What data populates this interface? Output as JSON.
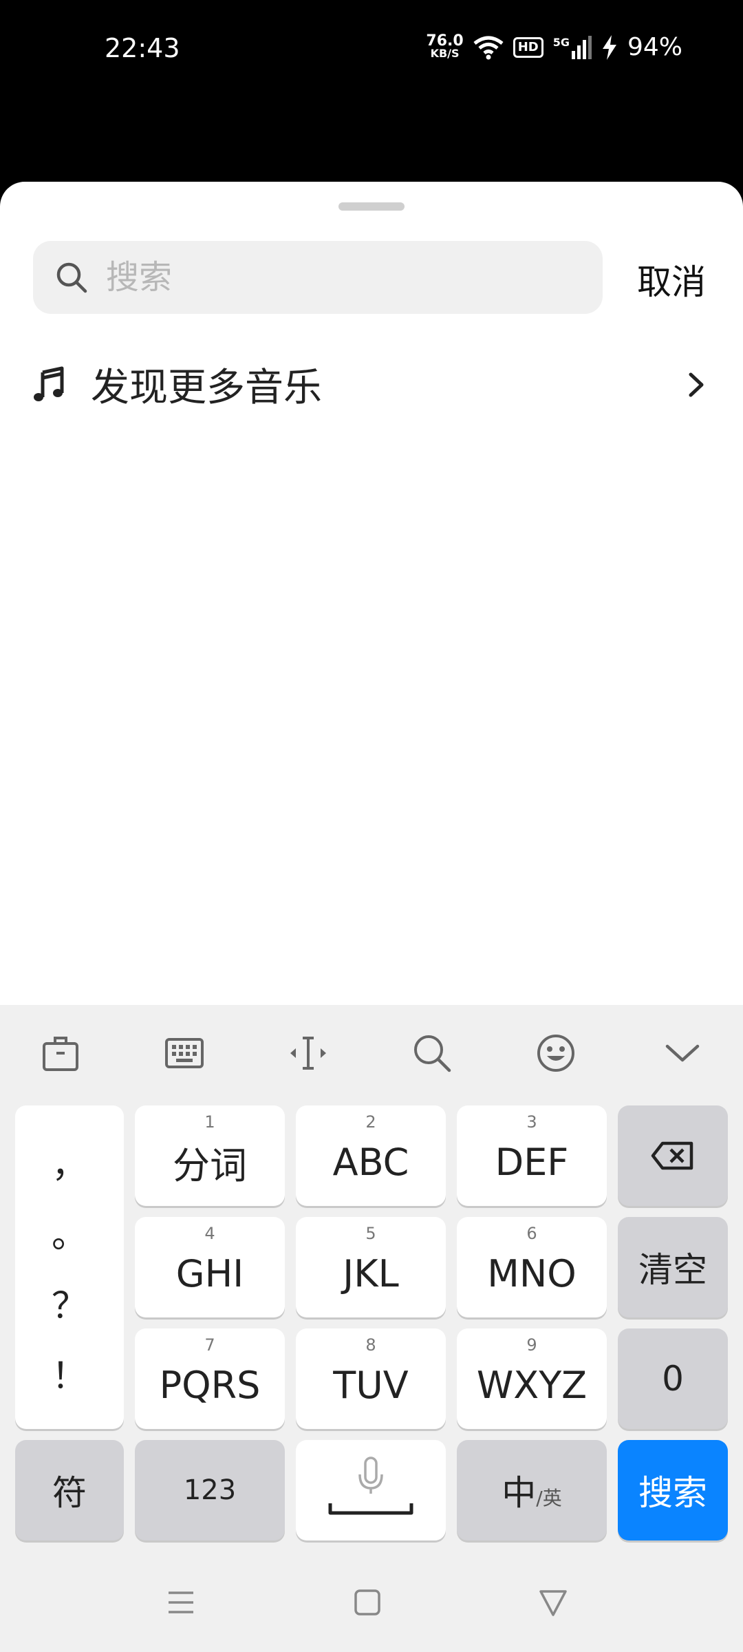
{
  "status": {
    "time": "22:43",
    "net_speed_value": "76.0",
    "net_speed_unit": "KB/S",
    "hd": "HD",
    "network": "5G",
    "battery": "94%"
  },
  "search": {
    "placeholder": "搜索",
    "value": "",
    "cancel_label": "取消"
  },
  "discover": {
    "label": "发现更多音乐"
  },
  "keyboard": {
    "toolbar_icons": [
      "toolbox-icon",
      "keyboard-icon",
      "cursor-icon",
      "search-icon",
      "emoji-icon",
      "collapse-icon"
    ],
    "punctuation": [
      "，",
      "。",
      "？",
      "！"
    ],
    "keys": [
      {
        "num": "1",
        "label": "分词"
      },
      {
        "num": "2",
        "label": "ABC"
      },
      {
        "num": "3",
        "label": "DEF"
      },
      {
        "num": "4",
        "label": "GHI"
      },
      {
        "num": "5",
        "label": "JKL"
      },
      {
        "num": "6",
        "label": "MNO"
      },
      {
        "num": "7",
        "label": "PQRS"
      },
      {
        "num": "8",
        "label": "TUV"
      },
      {
        "num": "9",
        "label": "WXYZ"
      }
    ],
    "clear_label": "清空",
    "zero_label": "0",
    "symbol_label": "符",
    "num_label": "123",
    "lang_main": "中",
    "lang_sub": "/英",
    "search_label": "搜索",
    "accent": "#0a84ff"
  }
}
